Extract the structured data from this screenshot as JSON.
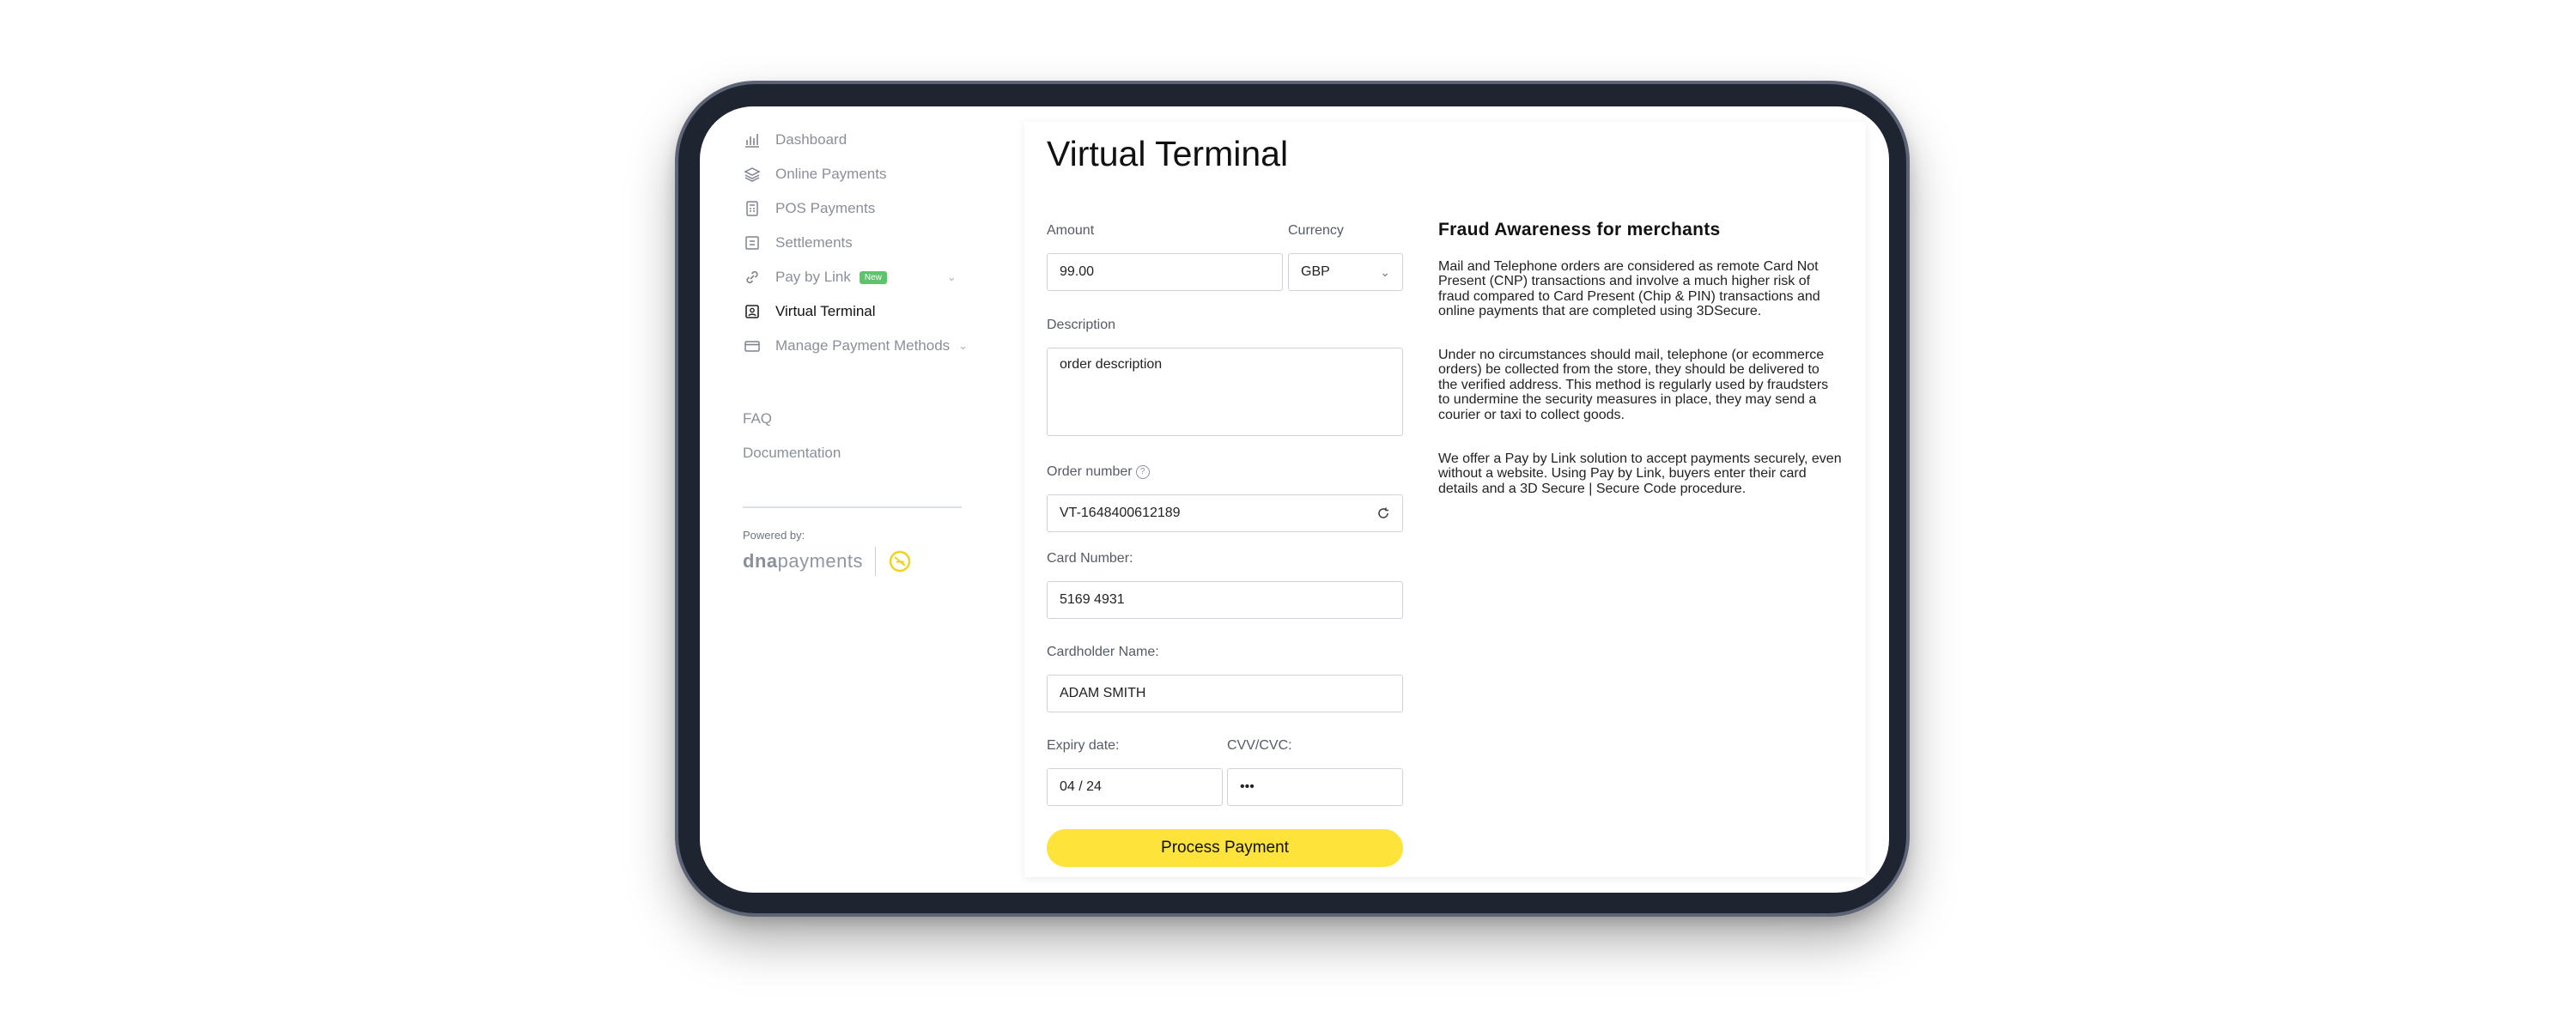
{
  "sidebar": {
    "items": [
      {
        "label": "Dashboard",
        "icon": "bar-chart-icon"
      },
      {
        "label": "Online Payments",
        "icon": "layers-icon"
      },
      {
        "label": "POS Payments",
        "icon": "pos-terminal-icon"
      },
      {
        "label": "Settlements",
        "icon": "settlements-icon"
      },
      {
        "label": "Pay by Link",
        "icon": "link-icon",
        "badge": "New"
      },
      {
        "label": "Virtual Terminal",
        "icon": "virtual-terminal-icon",
        "active": true
      },
      {
        "label": "Manage Payment Methods",
        "icon": "card-icon"
      }
    ],
    "links": [
      "FAQ",
      "Documentation"
    ],
    "powered_by": "Powered by:",
    "logo": {
      "part1": "dna",
      "part2": "payments"
    }
  },
  "main": {
    "title": "Virtual Terminal",
    "amount": {
      "label": "Amount",
      "value": "99.00"
    },
    "currency": {
      "label": "Currency",
      "value": "GBP"
    },
    "description": {
      "label": "Description",
      "value": "order description"
    },
    "order_number": {
      "label": "Order number",
      "value": "VT-1648400612189"
    },
    "card_number": {
      "label": "Card Number:",
      "value": "5169 4931"
    },
    "cardholder": {
      "label": "Cardholder Name:",
      "value": "ADAM SMITH"
    },
    "expiry": {
      "label": "Expiry date:",
      "value": "04 / 24"
    },
    "cvv": {
      "label": "CVV/CVC:",
      "value": "•••"
    },
    "submit_label": "Process Payment"
  },
  "fraud": {
    "title": "Fraud Awareness for merchants",
    "paragraphs": [
      "Mail and Telephone orders are considered as remote Card Not Present (CNP) transactions and involve a much higher risk of fraud compared to Card Present (Chip & PIN) transactions and online payments that are completed using 3DSecure.",
      "Under no circumstances should mail, telephone (or ecommerce orders) be collected from the store, they should be delivered to the verified address. This method is regularly used by fraudsters to undermine the security measures in place, they may send a courier or taxi to collect goods.",
      "We offer a Pay by Link solution to accept payments securely, even without a website. Using Pay by Link, buyers enter their card details and a 3D Secure | Secure Code procedure."
    ]
  },
  "colors": {
    "accent": "#fde33a",
    "badge": "#5cc46b",
    "bezel": "#1e2430"
  }
}
